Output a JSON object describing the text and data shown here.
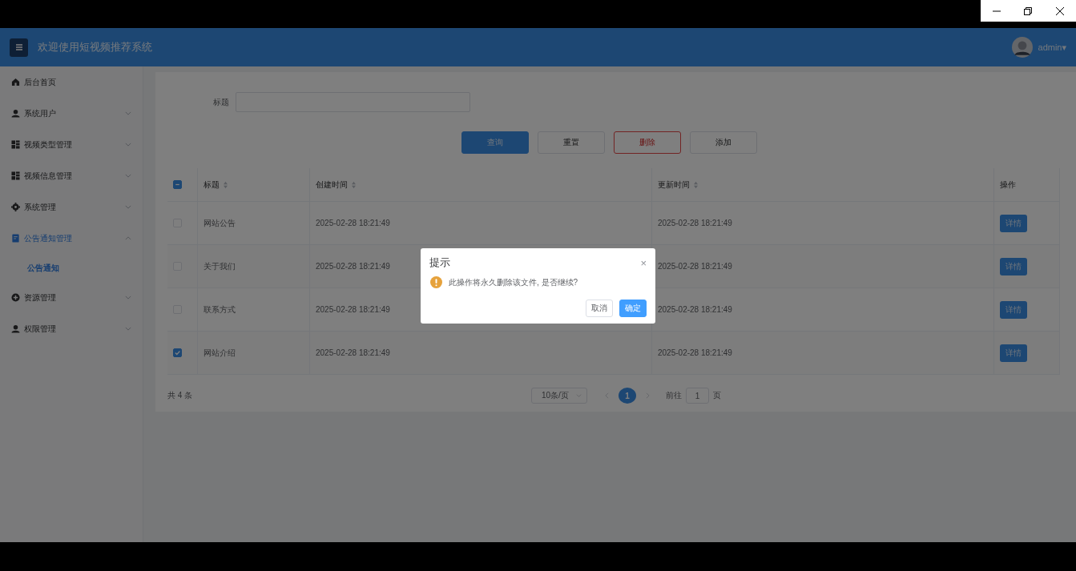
{
  "header": {
    "title": "欢迎使用短视频推荐系统",
    "user": {
      "name": "admin",
      "caret": "▾"
    }
  },
  "sidebar": {
    "items": [
      {
        "label": "后台首页",
        "kind": "home",
        "selected": false
      },
      {
        "label": "系统用户",
        "kind": "user",
        "selected": false,
        "expanded": false
      },
      {
        "label": "视频类型管理",
        "kind": "grid",
        "selected": false,
        "expanded": false
      },
      {
        "label": "视频信息管理",
        "kind": "grid",
        "selected": false,
        "expanded": false
      },
      {
        "label": "系统管理",
        "kind": "gear",
        "selected": false,
        "expanded": false
      },
      {
        "label": "公告通知管理",
        "kind": "doc",
        "selected": true,
        "expanded": true,
        "children": [
          {
            "label": "公告通知",
            "selected": true
          }
        ]
      },
      {
        "label": "资源管理",
        "kind": "plus",
        "selected": false,
        "expanded": false
      },
      {
        "label": "权限管理",
        "kind": "user",
        "selected": false,
        "expanded": false
      }
    ]
  },
  "search": {
    "label": "标题"
  },
  "buttons": [
    {
      "label": "查询",
      "kind": "primary"
    },
    {
      "label": "重置",
      "kind": "default"
    },
    {
      "label": "删除",
      "kind": "danger"
    },
    {
      "label": "添加",
      "kind": "default"
    }
  ],
  "table": {
    "header_checkbox": {
      "indeterminate": true
    },
    "columns": [
      {
        "label": "标题",
        "sortable": true
      },
      {
        "label": "创建时间",
        "sortable": true
      },
      {
        "label": "更新时间",
        "sortable": true
      },
      {
        "label": "操作",
        "sortable": false
      }
    ],
    "rows": [
      {
        "checked": false,
        "cells": [
          "网站公告",
          "2025-02-28 18:21:49",
          "2025-02-28 18:21:49"
        ],
        "action": "详情"
      },
      {
        "checked": false,
        "cells": [
          "关于我们",
          "2025-02-28 18:21:49",
          "2025-02-28 18:21:49"
        ],
        "action": "详情"
      },
      {
        "checked": false,
        "cells": [
          "联系方式",
          "2025-02-28 18:21:49",
          "2025-02-28 18:21:49"
        ],
        "action": "详情"
      },
      {
        "checked": true,
        "cells": [
          "网站介绍",
          "2025-02-28 18:21:49",
          "2025-02-28 18:21:49"
        ],
        "action": "详情"
      }
    ]
  },
  "pagination": {
    "total": "共 4 条",
    "page_size": "10条/页",
    "pages": [
      {
        "label": "1",
        "selected": true
      }
    ],
    "goto_label": "前往",
    "goto_value": "1",
    "goto_suffix": "页"
  },
  "dialog": {
    "title": "提示",
    "close": "×",
    "message": "此操作将永久删除该文件, 是否继续?",
    "buttons": [
      {
        "label": "取消",
        "kind": "default"
      },
      {
        "label": "确定",
        "kind": "primary"
      }
    ]
  }
}
